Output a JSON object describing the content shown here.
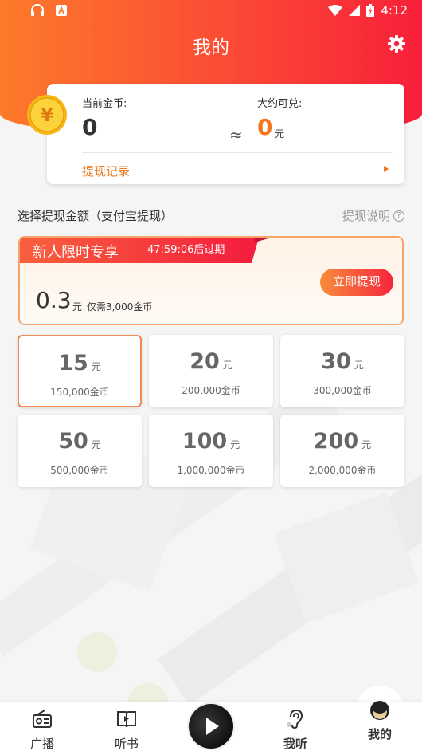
{
  "status_bar": {
    "time": "4:12"
  },
  "header": {
    "title": "我的"
  },
  "coins": {
    "current_label": "当前金币:",
    "current_value": "0",
    "exchange_label": "大约可兑:",
    "approx_symbol": "≈",
    "exchange_value": "0",
    "exchange_unit": "元",
    "record_link": "提现记录"
  },
  "withdraw": {
    "section_title": "选择提现金额（支付宝提现）",
    "explain_link": "提现说明",
    "help_glyph": "?"
  },
  "promo": {
    "title": "新人限时专享",
    "expire": "47:59:06后过期",
    "amount": "0.3",
    "unit": "元",
    "need": "仅需3,000金币",
    "button": "立即提现"
  },
  "options": [
    {
      "amount": "15",
      "unit": "元",
      "coins": "150,000金币"
    },
    {
      "amount": "20",
      "unit": "元",
      "coins": "200,000金币"
    },
    {
      "amount": "30",
      "unit": "元",
      "coins": "300,000金币"
    },
    {
      "amount": "50",
      "unit": "元",
      "coins": "500,000金币"
    },
    {
      "amount": "100",
      "unit": "元",
      "coins": "1,000,000金币"
    },
    {
      "amount": "200",
      "unit": "元",
      "coins": "2,000,000金币"
    }
  ],
  "nav": {
    "items": [
      {
        "label": "广播",
        "icon": "radio-icon"
      },
      {
        "label": "听书",
        "icon": "book-icon"
      },
      {
        "label": "我听",
        "icon": "ear-icon"
      },
      {
        "label": "我的",
        "icon": "avatar-icon"
      }
    ]
  },
  "colors": {
    "accent": "#f5243d",
    "orange": "#f07a1e"
  }
}
